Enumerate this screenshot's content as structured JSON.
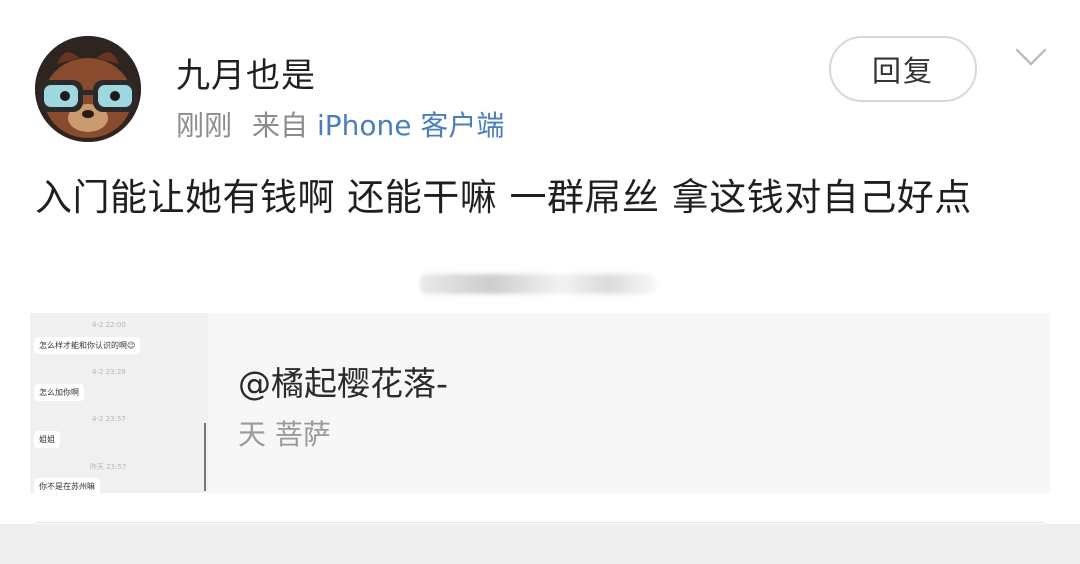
{
  "post": {
    "username": "九月也是",
    "time": "刚刚",
    "source_prefix": "来自",
    "source_app": "iPhone 客户端",
    "reply_label": "回复",
    "body": "入门能让她有钱啊 还能干嘛 一群屌丝 拿这钱对自己好点"
  },
  "quote": {
    "title": "@橘起樱花落-",
    "subtitle": "天 菩萨",
    "thumbnail": {
      "messages": [
        {
          "time": "4-2 22:00",
          "text": "怎么样才能和你认识的啊😉"
        },
        {
          "time": "4-2 23:28",
          "text": "怎么加你啊"
        },
        {
          "time": "4-2 23:57",
          "text": "姐姐"
        },
        {
          "time": "昨天 23:57",
          "text": "你不是在苏州嘛"
        }
      ]
    }
  },
  "colors": {
    "link": "#4a7fbd",
    "meta_text": "#8c8c8c",
    "quote_bg": "#f7f7f7"
  },
  "icons": {
    "avatar": "cartoon-dog-with-glasses",
    "more": "chevron-down-icon"
  }
}
